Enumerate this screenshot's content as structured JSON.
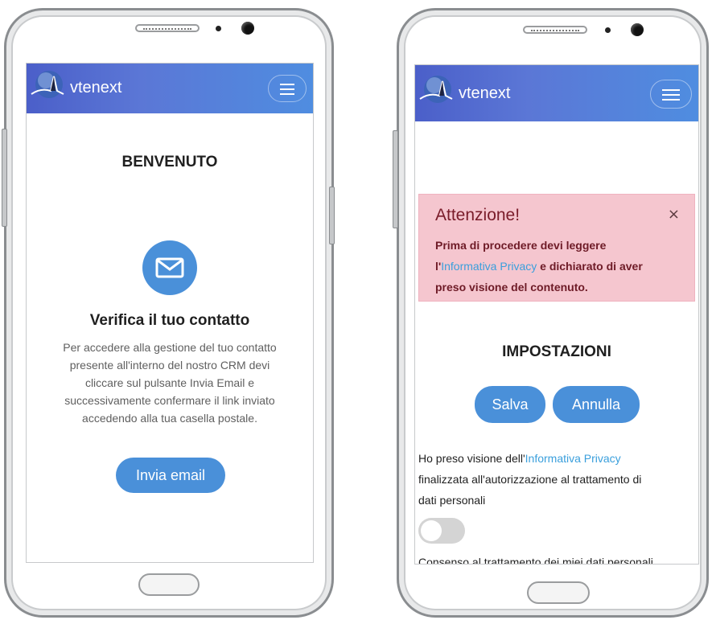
{
  "left_phone": {
    "app": {
      "brand": "vtenext"
    },
    "heading": "BENVENUTO",
    "icon": "envelope-icon",
    "subtitle": "Verifica il tuo contatto",
    "lines": [
      "Per accedere alla gestione del tuo contatto",
      "presente all'interno del nostro CRM devi",
      "cliccare sul pulsante Invia Email e",
      "successivamente confermare il link inviato",
      "accedendo alla tua casella postale."
    ],
    "send_button": "Invia email"
  },
  "right_phone": {
    "app": {
      "brand": "vtenext"
    },
    "alert": {
      "title": "Attenzione!",
      "close": "×",
      "line1": "Prima di procedere devi leggere",
      "line2_pre": "l'",
      "line2_link": "Informativa Privacy",
      "line2_post": " e dichiarato di aver",
      "line3": "preso visione del contenuto."
    },
    "heading": "IMPOSTAZIONI",
    "save_button": "Salva",
    "cancel_button": "Annulla",
    "consent": {
      "pre": "Ho preso visione dell'",
      "link": "Informativa Privacy",
      "line2": "finalizzata all'autorizzazione al trattamento di",
      "line3": "dati personali"
    },
    "toggle_on": false,
    "cut_text": "Consenso al trattamento dei miei dati personali"
  },
  "colors": {
    "header_start": "#4b5fc9",
    "header_end": "#4f8de0",
    "accent": "#4a90d9",
    "alert_bg": "#f5c6cf"
  }
}
